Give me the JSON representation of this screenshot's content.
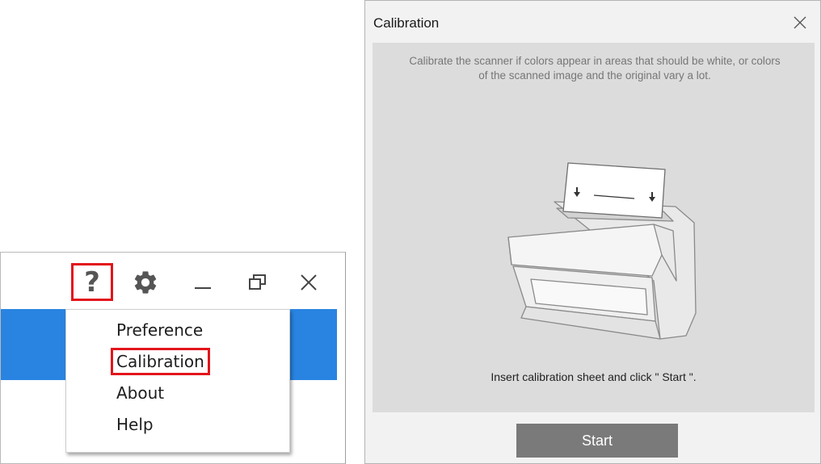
{
  "app": {
    "help_label": "?",
    "menu": {
      "items": [
        {
          "label": "Preference"
        },
        {
          "label": "Calibration"
        },
        {
          "label": "About"
        },
        {
          "label": "Help"
        }
      ]
    },
    "icons": [
      "help-icon",
      "gear-icon",
      "minimize-icon",
      "restore-icon",
      "close-icon"
    ],
    "colors": {
      "accent_band": "#2984e1",
      "highlight": "#e2151b"
    }
  },
  "dialog": {
    "title": "Calibration",
    "description": "Calibrate the scanner if colors appear in areas that should be white, or colors of the scanned image and the original vary a lot.",
    "instruction": "Insert calibration sheet and click \" Start \".",
    "start_label": "Start",
    "colors": {
      "panel": "#dcdcdc",
      "button": "#7a7a7a"
    }
  }
}
